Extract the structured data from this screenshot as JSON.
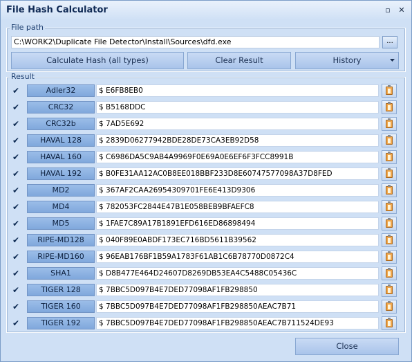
{
  "window": {
    "title": "File Hash Calculator",
    "minimize_glyph": "▫",
    "close_glyph": "✕"
  },
  "file_path": {
    "legend": "File path",
    "value": "C:\\WORK2\\Duplicate File Detector\\Install\\Sources\\dfd.exe",
    "browse_label": "..."
  },
  "actions": {
    "calculate_label": "Calculate Hash (all types)",
    "clear_label": "Clear Result",
    "history_label": "History"
  },
  "result": {
    "legend": "Result",
    "rows": [
      {
        "name": "Adler32",
        "value": "$ E6FB8EB0"
      },
      {
        "name": "CRC32",
        "value": "$ B5168DDC"
      },
      {
        "name": "CRC32b",
        "value": "$ 7AD5E692"
      },
      {
        "name": "HAVAL 128",
        "value": "$ 2839D06277942BDE28DE73CA3EB92D58"
      },
      {
        "name": "HAVAL 160",
        "value": "$ C6986DA5C9AB4A9969F0E69A0E6EF6F3FCC8991B"
      },
      {
        "name": "HAVAL 192",
        "value": "$ B0FE31AA12AC0B8EE018BBF233D8E60747577098A37D8FED"
      },
      {
        "name": "MD2",
        "value": "$ 367AF2CAA26954309701FE6E413D9306"
      },
      {
        "name": "MD4",
        "value": "$ 782053FC2844E47B1E058BEB9BFAEFC8"
      },
      {
        "name": "MD5",
        "value": "$ 1FAE7C89A17B1891EFD616ED86898494"
      },
      {
        "name": "RIPE-MD128",
        "value": "$ 040F89E0ABDF173EC716BD5611B39562"
      },
      {
        "name": "RIPE-MD160",
        "value": "$ 96EAB176BF1B59A1783F61AB1C6B78770D0872C4"
      },
      {
        "name": "SHA1",
        "value": "$ D8B477E464D24607D8269DB53EA4C5488C05436C"
      },
      {
        "name": "TIGER 128",
        "value": "$ 7BBC5D097B4E7DED77098AF1FB298850"
      },
      {
        "name": "TIGER 160",
        "value": "$ 7BBC5D097B4E7DED77098AF1FB298850AEAC7B71"
      },
      {
        "name": "TIGER 192",
        "value": "$ 7BBC5D097B4E7DED77098AF1FB298850AEAC7B711524DE93"
      }
    ],
    "check_glyph": "✔"
  },
  "footer": {
    "close_label": "Close"
  },
  "colors": {
    "window_bg": "#cfe0f5",
    "button": "#a9c4ea",
    "algo_label": "#80a8dc",
    "clipboard": "#f0a64a"
  },
  "icons": [
    "check-icon",
    "clipboard-icon",
    "chevron-down-icon"
  ]
}
